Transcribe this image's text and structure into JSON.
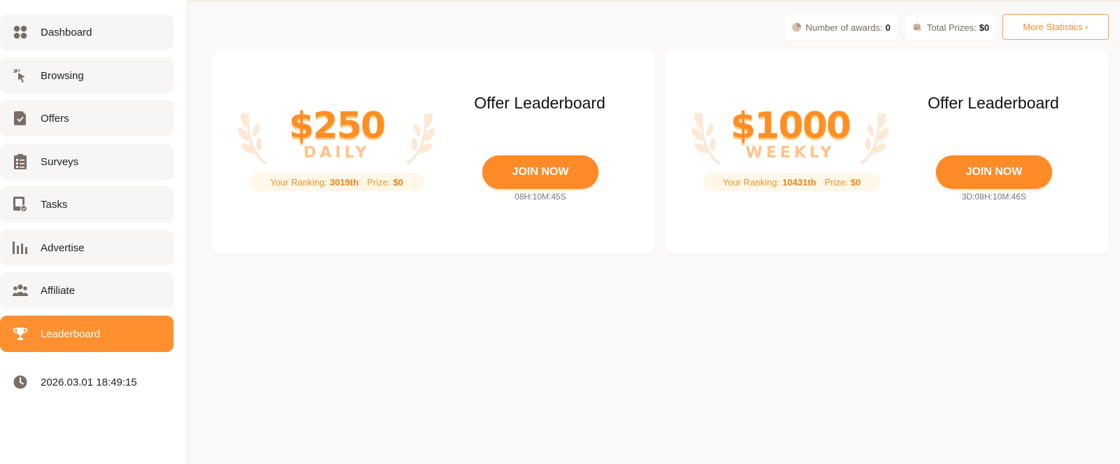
{
  "sidebar": {
    "items": [
      {
        "label": "Dashboard",
        "icon": "dashboard-icon"
      },
      {
        "label": "Browsing",
        "icon": "cursor-click-icon"
      },
      {
        "label": "Offers",
        "icon": "offer-document-icon"
      },
      {
        "label": "Surveys",
        "icon": "clipboard-list-icon"
      },
      {
        "label": "Tasks",
        "icon": "tablet-check-icon"
      },
      {
        "label": "Advertise",
        "icon": "bar-chart-icon"
      },
      {
        "label": "Affiliate",
        "icon": "users-group-icon"
      },
      {
        "label": "Leaderboard",
        "icon": "trophy-icon",
        "active": true
      }
    ],
    "datetime": "2026.03.01 18:49:15"
  },
  "stats": {
    "awards_label": "Number of awards:",
    "awards_value": "0",
    "prizes_label": "Total Prizes:",
    "prizes_value": "$0",
    "more_button": "More Statistics ›"
  },
  "cards": [
    {
      "amount": "$250",
      "period": "DAILY",
      "ranking_label": "Your Ranking:",
      "ranking_value": "3019th",
      "prize_label": "Prize:",
      "prize_value": "$0",
      "title": "Offer Leaderboard",
      "button": "JOIN NOW",
      "timer": "08H:10M:45S"
    },
    {
      "amount": "$1000",
      "period": "WEEKLY",
      "ranking_label": "Your Ranking:",
      "ranking_value": "10431th",
      "prize_label": "Prize:",
      "prize_value": "$0",
      "title": "Offer Leaderboard",
      "button": "JOIN NOW",
      "timer": "3D:08H:10M:46S"
    }
  ],
  "colors": {
    "accent": "#ff8a28",
    "accent_light": "#ffc38a",
    "background": "#faf9f8"
  }
}
